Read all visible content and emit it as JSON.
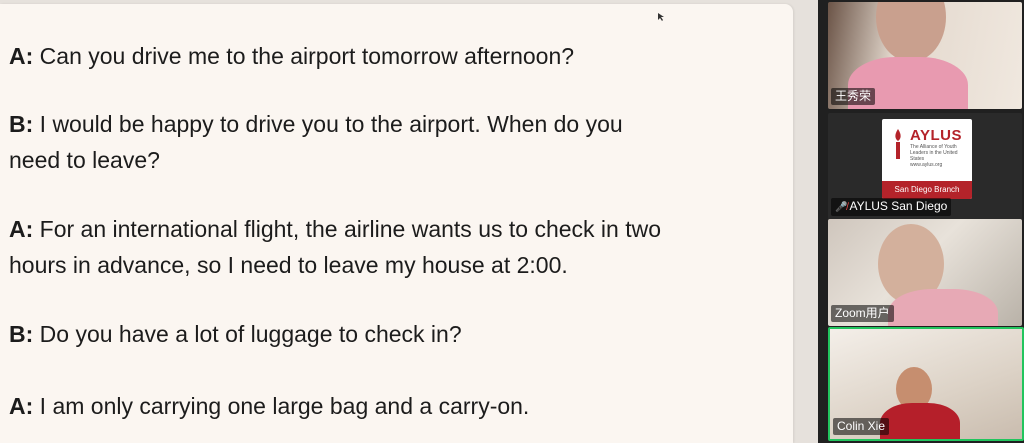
{
  "dialogue": [
    {
      "speaker": "A:",
      "lines": [
        "Can you drive me to the airport tomorrow afternoon?"
      ]
    },
    {
      "speaker": "B:",
      "lines": [
        "I would be happy to drive you to the airport. When do you",
        "need to leave?"
      ]
    },
    {
      "speaker": "A:",
      "lines": [
        "For an international flight, the airline wants us to check in two",
        "hours in advance, so I need to leave my house at 2:00."
      ]
    },
    {
      "speaker": "B:",
      "lines": [
        "Do you have a lot of luggage to check in?"
      ]
    },
    {
      "speaker": "A:",
      "lines": [
        "I am only carrying one large bag and a carry-on."
      ]
    }
  ],
  "participants": [
    {
      "name": "王秀荣",
      "muted": false
    },
    {
      "name": "AYLUS San Diego",
      "muted": true
    },
    {
      "name": "Zoom用户",
      "muted": false
    },
    {
      "name": "Colin Xie",
      "muted": false,
      "active_speaker": true
    }
  ],
  "aylus_logo": {
    "title": "AYLUS",
    "subtitle": "The Alliance of Youth Leaders in the United States",
    "url": "www.aylus.org",
    "branch": "San Diego Branch"
  },
  "colors": {
    "document_bg": "#fbf6f1",
    "active_speaker_border": "#22c55e",
    "aylus_red": "#b4232a"
  }
}
